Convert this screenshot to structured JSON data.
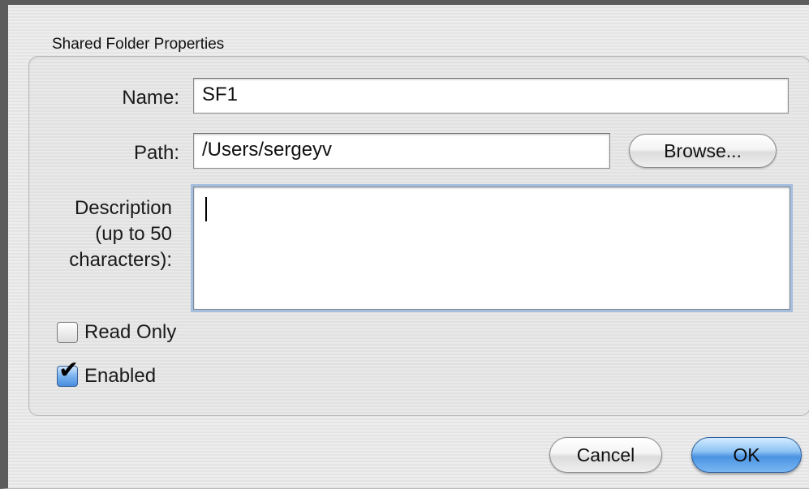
{
  "dialog": {
    "group_title": "Shared Folder Properties"
  },
  "form": {
    "name_label": "Name:",
    "name_value": "SF1",
    "path_label": "Path:",
    "path_value": "/Users/sergeyv",
    "browse_label": "Browse...",
    "description_label_line1": "Description",
    "description_label_line2": "(up to 50",
    "description_label_line3": "characters):",
    "description_value": "",
    "read_only_label": "Read Only",
    "read_only_checked": false,
    "enabled_label": "Enabled",
    "enabled_checked": true
  },
  "buttons": {
    "cancel_label": "Cancel",
    "ok_label": "OK"
  },
  "colors": {
    "default_button": "#4b93e2",
    "focus_ring": "#a6bfdc"
  },
  "icons": {
    "checkmark": "check-icon"
  }
}
